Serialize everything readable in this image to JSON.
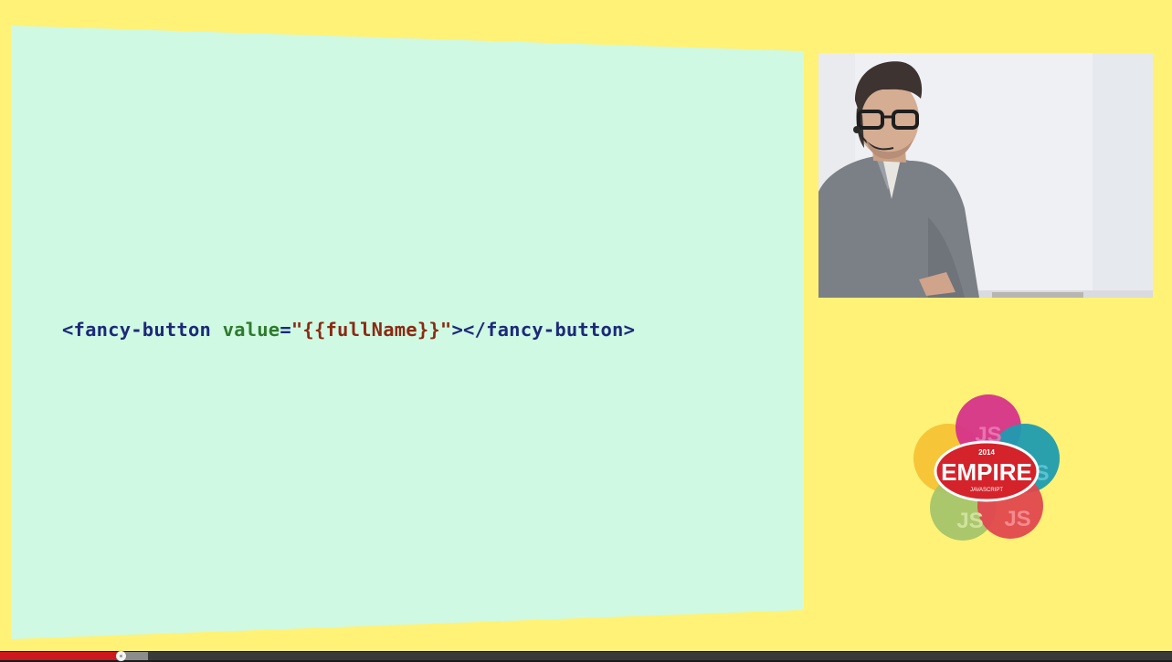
{
  "video": {
    "progress_played_percent": 10.4,
    "progress_buffered_percent": 12.6
  },
  "slide": {
    "background_color": "#fff276",
    "panel_color": "#cff9e3",
    "code_tokens": {
      "open_tag": "<fancy-button ",
      "attr_name": "value",
      "equals": "=",
      "attr_value": "\"{{fullName}}\"",
      "close": "></fancy-button>"
    }
  },
  "logo": {
    "year": "2014",
    "name": "EMPIRE",
    "sub": "JAVASCRIPT",
    "petal_labels": [
      "JS",
      "JS",
      "JS",
      "JS"
    ]
  },
  "speaker_feed": {
    "icon": "speaker-camera-icon"
  }
}
